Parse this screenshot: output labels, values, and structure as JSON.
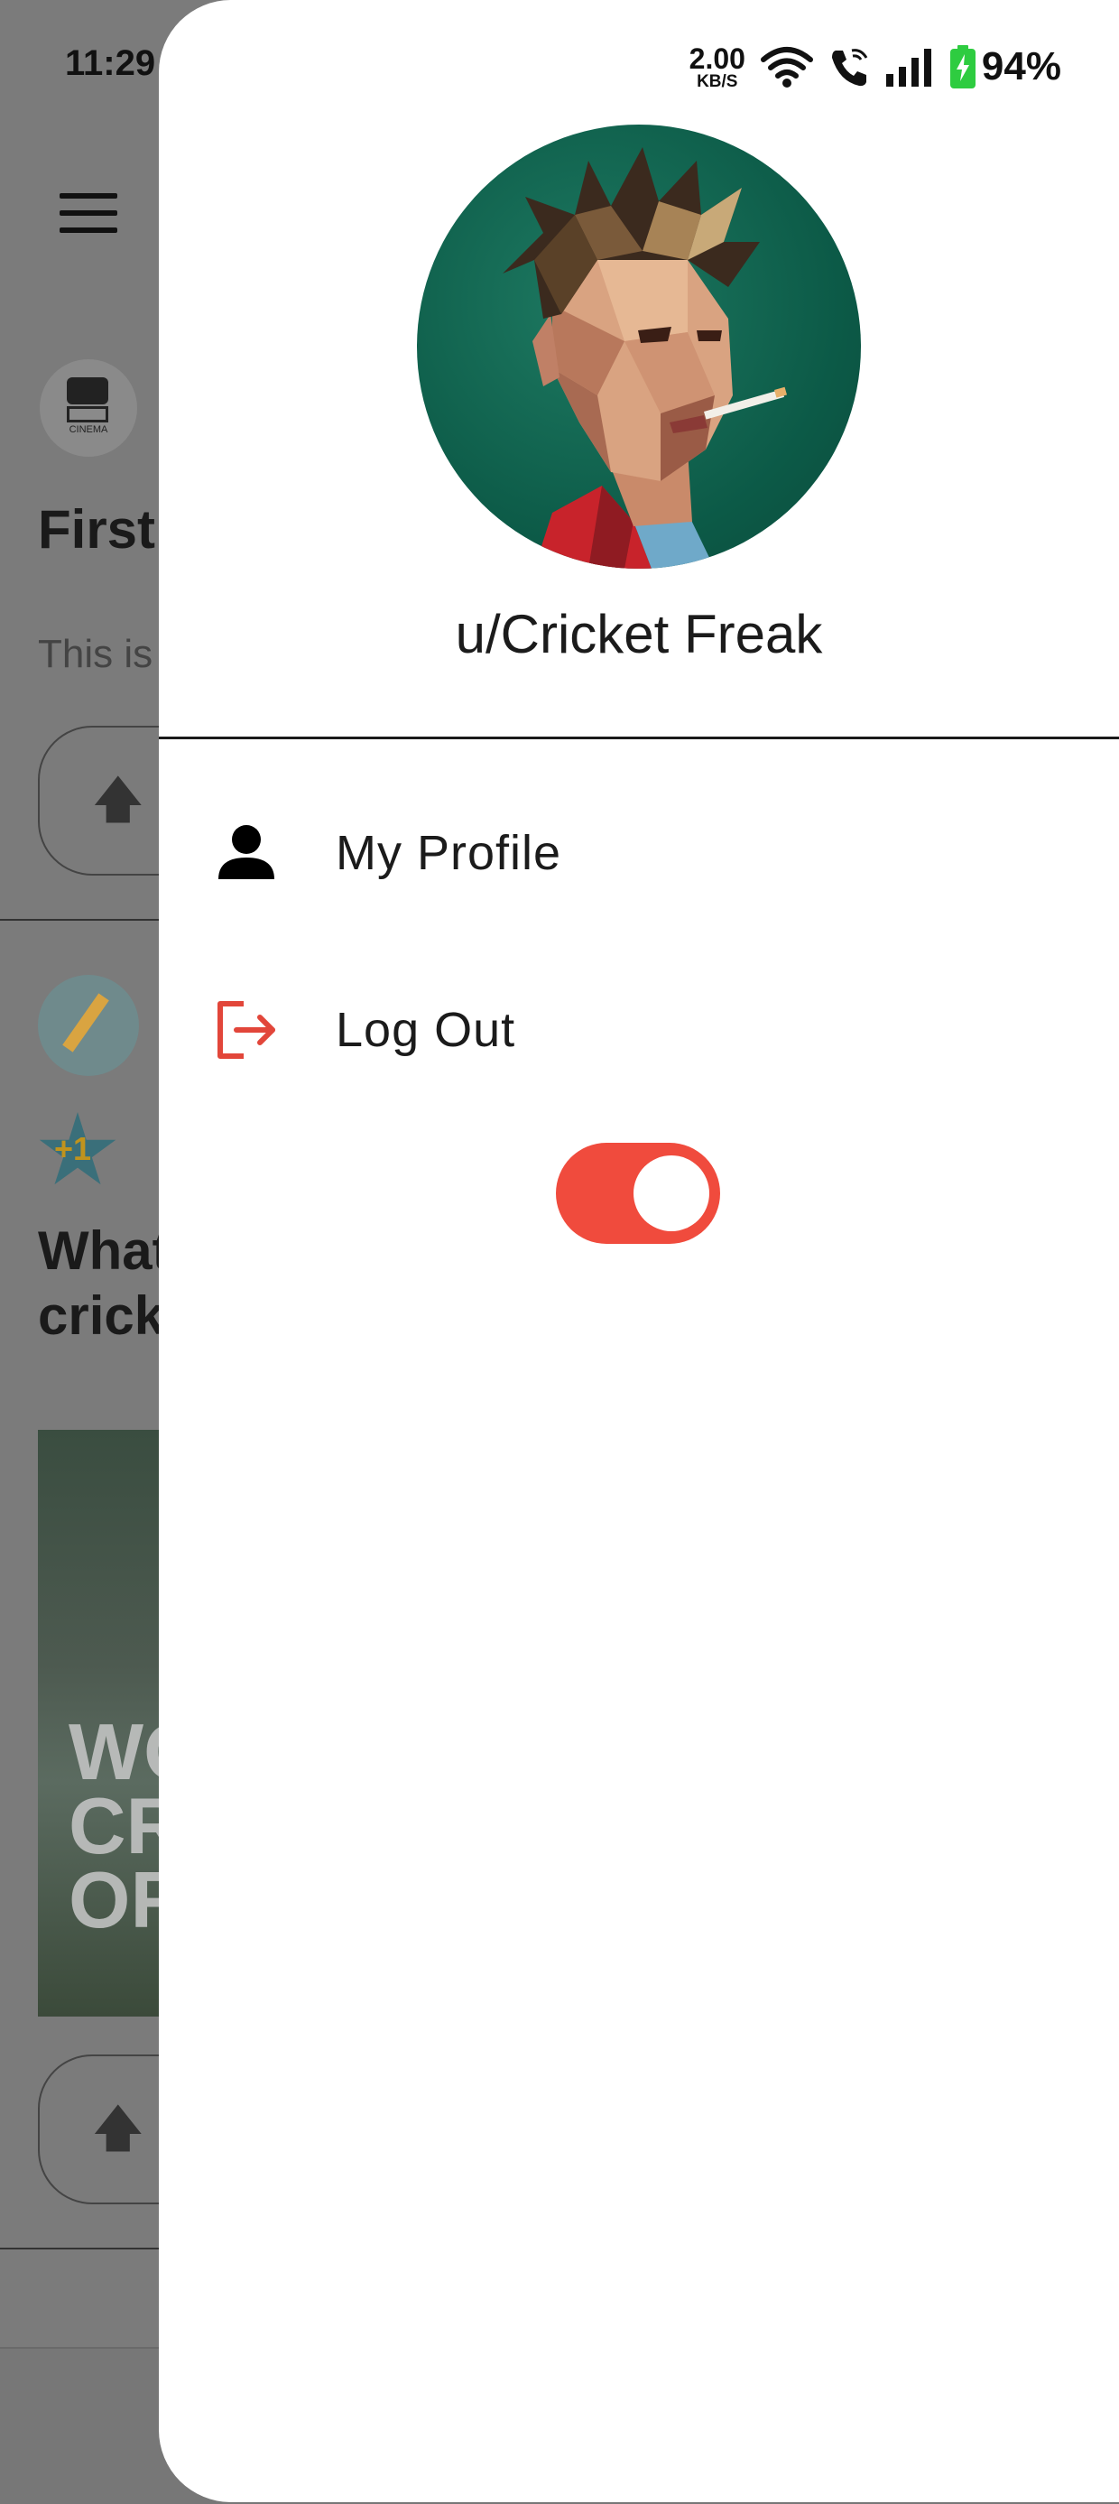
{
  "status_bar": {
    "time": "11:29",
    "net_speed_value": "2.00",
    "net_speed_unit": "KB/S",
    "battery_percent": "94%"
  },
  "background_feed": {
    "post1": {
      "community_icon_text": "CINEMA",
      "title": "First",
      "body": "This is"
    },
    "post2": {
      "badge_text": "+1",
      "title_line1": "What",
      "title_line2": "crick",
      "image_text_lines": [
        "WO",
        "CR",
        "OF"
      ]
    }
  },
  "drawer": {
    "username": "u/Cricket Freak",
    "menu": [
      {
        "label": "My Profile",
        "icon": "person-icon"
      },
      {
        "label": "Log Out",
        "icon": "logout-icon"
      }
    ],
    "theme_toggle": {
      "on": true
    }
  },
  "colors": {
    "accent": "#f04b3d",
    "logout_icon": "#e2463a",
    "avatar_bg": "#0c5a47",
    "scrim": "#7b7b7b",
    "battery_fill": "#2ecc40"
  }
}
